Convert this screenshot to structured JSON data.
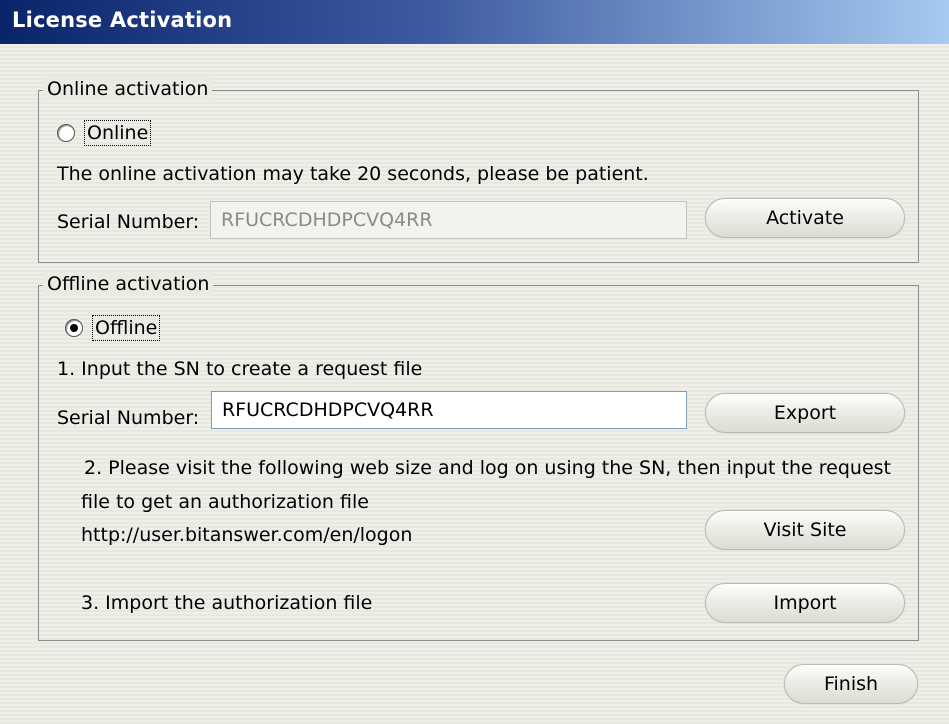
{
  "window": {
    "title": "License Activation"
  },
  "online": {
    "group_label": "Online activation",
    "radio_label": "Online",
    "radio_checked": false,
    "note": "The online activation may take 20 seconds, please be patient.",
    "serial_label": "Serial Number:",
    "serial_value": "RFUCRCDHDPCVQ4RR",
    "activate_label": "Activate"
  },
  "offline": {
    "group_label": "Offline activation",
    "radio_label": "Offline",
    "radio_checked": true,
    "step1": "1. Input the SN to create a request file",
    "serial_label": "Serial Number:",
    "serial_value": "RFUCRCDHDPCVQ4RR",
    "export_label": "Export",
    "step2_line1": "2. Please visit the following web size and log on using the SN, then input the request",
    "step2_line2": "file to get an authorization file",
    "url": "http://user.bitanswer.com/en/logon",
    "visit_label": "Visit Site",
    "step3": "3. Import the authorization file",
    "import_label": "Import"
  },
  "footer": {
    "finish_label": "Finish"
  }
}
